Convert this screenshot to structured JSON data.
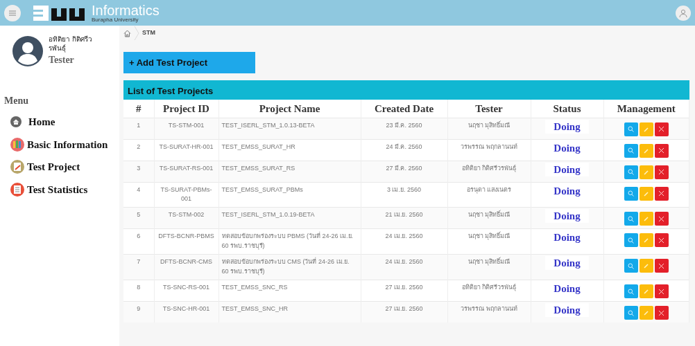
{
  "header": {
    "logo_text": "Informatics",
    "logo_subtext": "Burapha University"
  },
  "breadcrumb": [
    {
      "label": "STM"
    }
  ],
  "user": {
    "name": "อทิติยา กิติศรีวรพันธุ์",
    "role": "Tester"
  },
  "sidebar": {
    "heading": "Menu",
    "items": [
      {
        "label": "Home"
      },
      {
        "label": "Basic Information"
      },
      {
        "label": "Test Project"
      },
      {
        "label": "Test Statistics"
      }
    ]
  },
  "add_button": "+ Add Test Project",
  "table": {
    "title": "List of Test Projects",
    "columns": [
      "#",
      "Project ID",
      "Project Name",
      "Created Date",
      "Tester",
      "Status",
      "Management"
    ],
    "rows": [
      {
        "no": "1",
        "id": "TS-STM-001",
        "name": "TEST_ISERL_STM_1.0.13-BETA",
        "date": "23 มี.ค. 2560",
        "tester": "นฤชา มุสิทธิ์มณี",
        "status": "Doing"
      },
      {
        "no": "2",
        "id": "TS-SURAT-HR-001",
        "name": "TEST_EMSS_SURAT_HR",
        "date": "24 มี.ค. 2560",
        "tester": "วรพรรณ พฤกลานนท์",
        "status": "Doing"
      },
      {
        "no": "3",
        "id": "TS-SURAT-RS-001",
        "name": "TEST_EMSS_SURAT_RS",
        "date": "27 มี.ค. 2560",
        "tester": "อทิติยา กิติศรีวรพันธุ์",
        "status": "Doing"
      },
      {
        "no": "4",
        "id": "TS-SURAT-PBMs-001",
        "name": "TEST_EMSS_SURAT_PBMs",
        "date": "3 เม.ย. 2560",
        "tester": "อรนุดา แสงเนตร",
        "status": "Doing"
      },
      {
        "no": "5",
        "id": "TS-STM-002",
        "name": "TEST_ISERL_STM_1.0.19-BETA",
        "date": "21 เม.ย. 2560",
        "tester": "นฤชา มุสิทธิ์มณี",
        "status": "Doing"
      },
      {
        "no": "6",
        "id": "DFTS-BCNR-PBMS",
        "name": "ทดสอบข้อบกพร่องระบบ PBMS (วันที่ 24-26 เม.ย. 60 รพบ.ราชบุรี)",
        "date": "24 เม.ย. 2560",
        "tester": "นฤชา มุสิทธิ์มณี",
        "status": "Doing"
      },
      {
        "no": "7",
        "id": "DFTS-BCNR-CMS",
        "name": "ทดสอบข้อบกพร่องระบบ CMS (วันที่ 24-26 เม.ย. 60 รพบ.ราชบุรี)",
        "date": "24 เม.ย. 2560",
        "tester": "นฤชา มุสิทธิ์มณี",
        "status": "Doing"
      },
      {
        "no": "8",
        "id": "TS-SNC-RS-001",
        "name": "TEST_EMSS_SNC_RS",
        "date": "27 เม.ย. 2560",
        "tester": "อทิติยา กิติศรีวรพันธุ์",
        "status": "Doing"
      },
      {
        "no": "9",
        "id": "TS-SNC-HR-001",
        "name": "TEST_EMSS_SNC_HR",
        "date": "27 เม.ย. 2560",
        "tester": "วรพรรณ พฤกลานนท์",
        "status": "Doing"
      }
    ]
  }
}
